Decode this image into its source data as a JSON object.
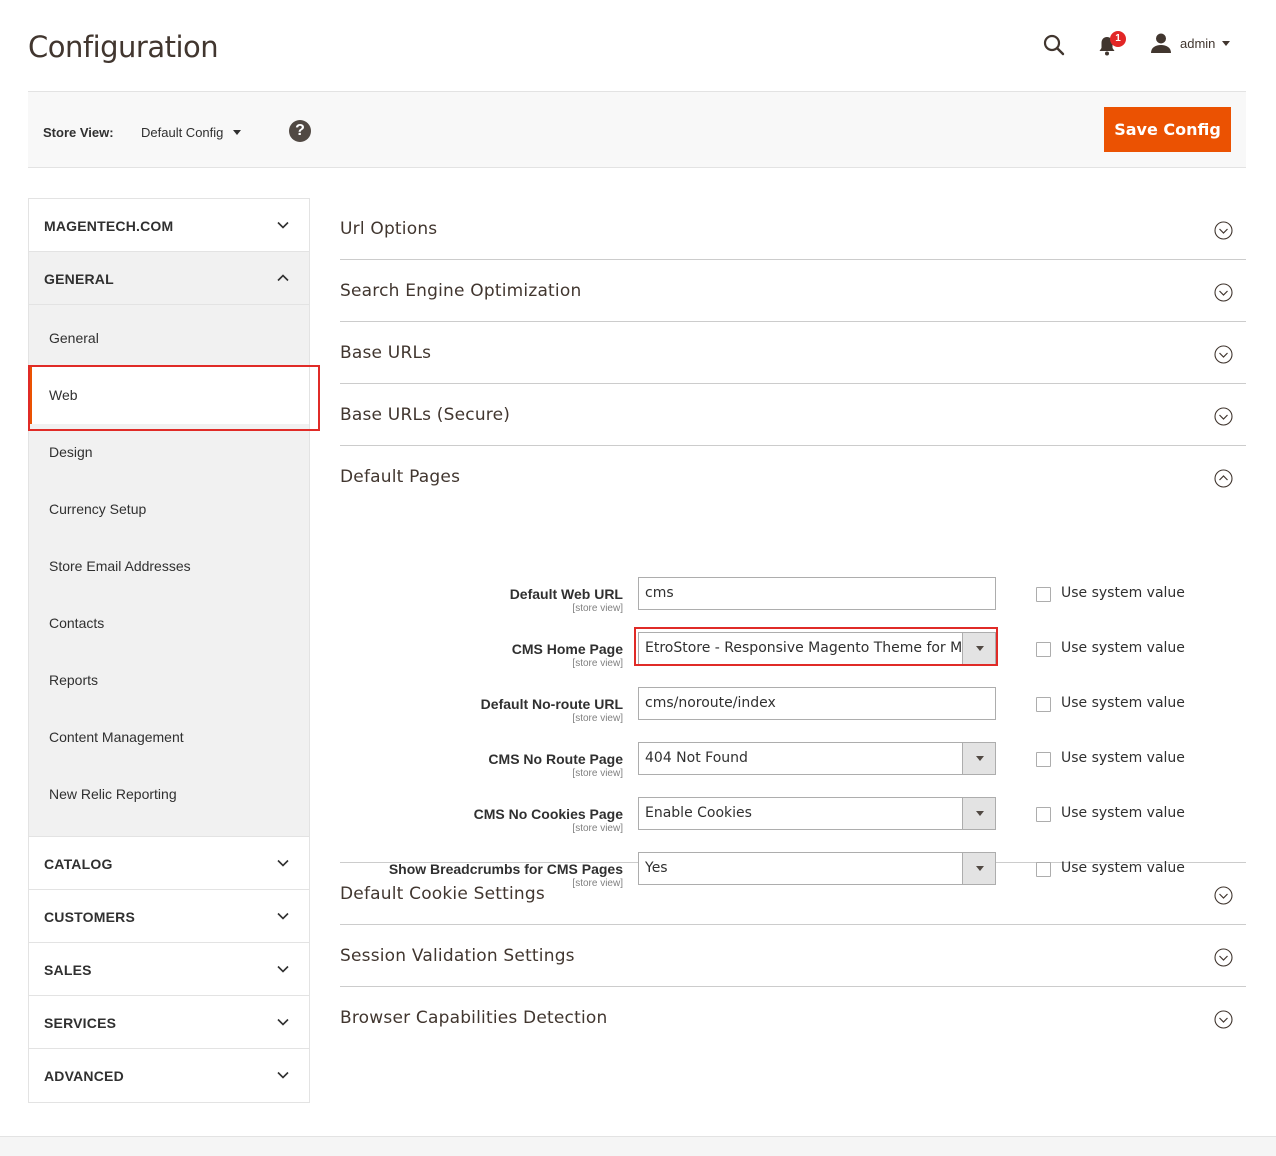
{
  "page": {
    "title": "Configuration"
  },
  "header": {
    "admin_name": "admin",
    "notification_count": "1"
  },
  "toolbar": {
    "store_view_label": "Store View:",
    "store_view_value": "Default Config",
    "help_symbol": "?",
    "save_label": "Save Config"
  },
  "sidebar": {
    "sections": [
      {
        "label": "MAGENTECH.COM"
      },
      {
        "label": "GENERAL"
      },
      {
        "label": "CATALOG"
      },
      {
        "label": "CUSTOMERS"
      },
      {
        "label": "SALES"
      },
      {
        "label": "SERVICES"
      },
      {
        "label": "ADVANCED"
      }
    ],
    "general_items": [
      {
        "label": "General"
      },
      {
        "label": "Web"
      },
      {
        "label": "Design"
      },
      {
        "label": "Currency Setup"
      },
      {
        "label": "Store Email Addresses"
      },
      {
        "label": "Contacts"
      },
      {
        "label": "Reports"
      },
      {
        "label": "Content Management"
      },
      {
        "label": "New Relic Reporting"
      }
    ]
  },
  "content": {
    "sections_before": [
      {
        "title": "Url Options"
      },
      {
        "title": "Search Engine Optimization"
      },
      {
        "title": "Base URLs"
      },
      {
        "title": "Base URLs (Secure)"
      },
      {
        "title": "Default Pages"
      }
    ],
    "fields": [
      {
        "label": "Default Web URL",
        "scope": "[store view]",
        "value": "cms",
        "type": "text",
        "use_system": "Use system value"
      },
      {
        "label": "CMS Home Page",
        "scope": "[store view]",
        "value": "EtroStore - Responsive Magento Theme for Mul",
        "type": "select",
        "use_system": "Use system value"
      },
      {
        "label": "Default No-route URL",
        "scope": "[store view]",
        "value": "cms/noroute/index",
        "type": "text",
        "use_system": "Use system value"
      },
      {
        "label": "CMS No Route Page",
        "scope": "[store view]",
        "value": "404 Not Found",
        "type": "select",
        "use_system": "Use system value"
      },
      {
        "label": "CMS No Cookies Page",
        "scope": "[store view]",
        "value": "Enable Cookies",
        "type": "select",
        "use_system": "Use system value"
      },
      {
        "label": "Show Breadcrumbs for CMS Pages",
        "scope": "[store view]",
        "value": "Yes",
        "type": "select",
        "use_system": "Use system value"
      }
    ],
    "sections_after": [
      {
        "title": "Default Cookie Settings"
      },
      {
        "title": "Session Validation Settings"
      },
      {
        "title": "Browser Capabilities Detection"
      }
    ]
  },
  "colors": {
    "accent": "#eb5202",
    "highlight": "#e02b27",
    "badge": "#e22626"
  }
}
